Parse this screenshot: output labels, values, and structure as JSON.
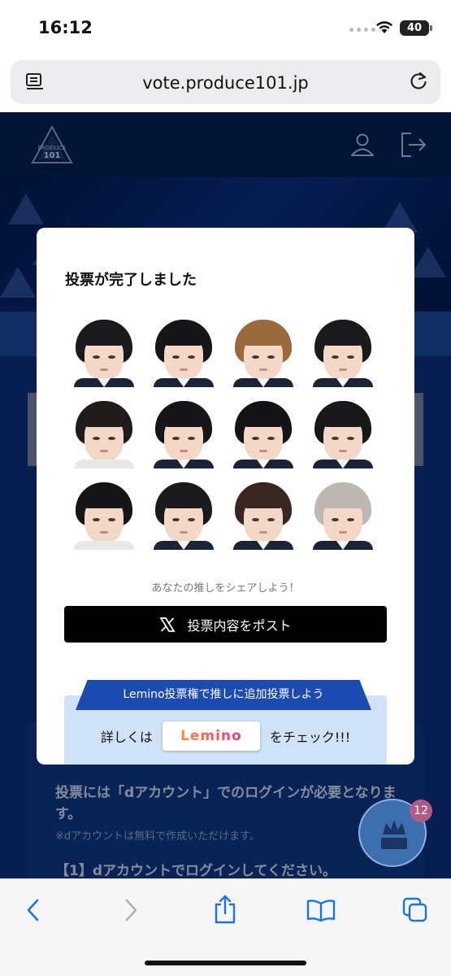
{
  "status_bar": {
    "time": "16:12",
    "battery": "40"
  },
  "browser": {
    "url": "vote.produce101.jp"
  },
  "site": {
    "logo_text": "PRODUCE 101"
  },
  "modal": {
    "title": "投票が完了しました",
    "share_prompt": "あなたの推しをシェアしよう！",
    "post_button": "投票内容をポスト",
    "lemino_banner": "Lemino投票権で推しに追加投票しよう",
    "check_prefix": "詳しくは",
    "lemino_logo": "Lemino",
    "check_suffix": "をチェック!!!"
  },
  "background_info": {
    "login_required": "投票には「dアカウント」でのログインが必要となります。",
    "free_note": "※dアカウントは無料で作成いただけます。",
    "step1": "【1】dアカウントでログインしてください。"
  },
  "floating_badge": {
    "count": "12"
  },
  "colors": {
    "page_bg": "#0b2f77",
    "header_bg": "#081d46",
    "post_button": "#000000",
    "lemino_banner": "#1b4bb0",
    "lemino_box": "#cfe2f8",
    "badge": "#b15c86"
  },
  "icons": [
    "reader-icon",
    "reload-icon",
    "user-icon",
    "logout-icon",
    "x-logo-icon",
    "crown-vote-icon",
    "back-icon",
    "forward-icon",
    "share-icon",
    "bookmarks-icon",
    "tabs-icon"
  ]
}
